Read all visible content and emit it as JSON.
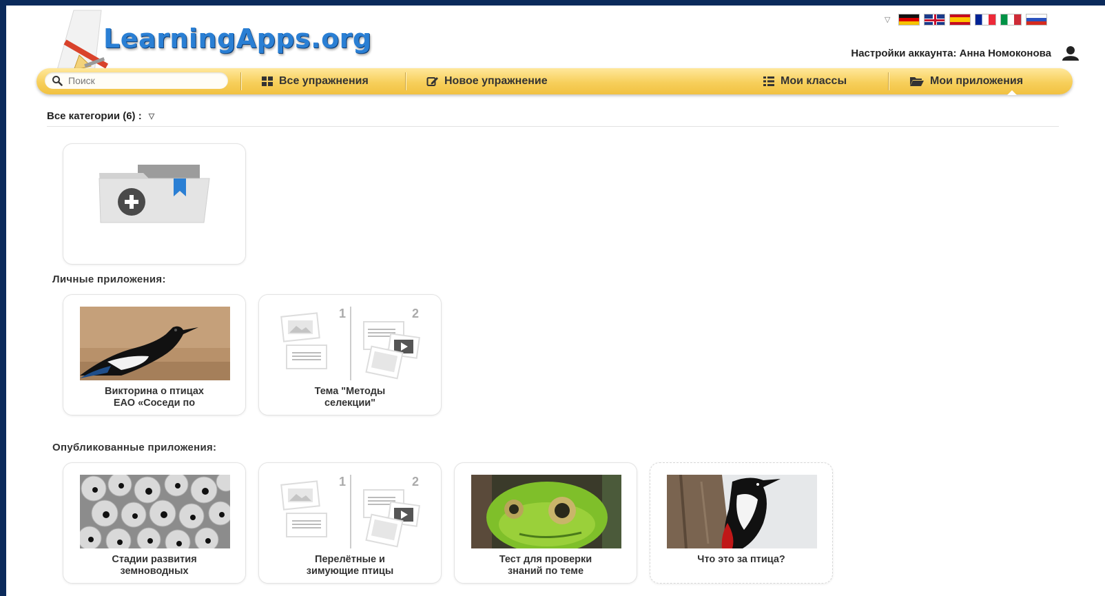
{
  "header": {
    "logo_text": "LearningApps.org",
    "account_label": "Настройки аккаунта: Анна Номоконова",
    "languages": [
      "de",
      "gb",
      "es",
      "fr",
      "it",
      "ru"
    ]
  },
  "nav": {
    "search_placeholder": "Поиск",
    "all_exercises": "Все упражнения",
    "new_exercise": "Новое упражнение",
    "my_classes": "Мои классы",
    "my_apps": "Мои приложения",
    "active": "my_apps"
  },
  "categories": {
    "label": "Все категории (6) :"
  },
  "sections": {
    "personal": {
      "title": "Личные приложения:",
      "apps": [
        {
          "title_line1": "Викторина о птицах",
          "title_line2": "ЕАО «Соседи по",
          "thumb": "magpie-photo"
        },
        {
          "title_line1": "Тема \"Методы",
          "title_line2": "селекции\"",
          "thumb": "app-template-placeholder",
          "step1": "1",
          "step2": "2"
        }
      ]
    },
    "published": {
      "title": "Опубликованные приложения:",
      "apps": [
        {
          "title_line1": "Стадии развития",
          "title_line2": "земноводных",
          "thumb": "frog-eggs-photo"
        },
        {
          "title_line1": "Перелётные и",
          "title_line2": "зимующие птицы",
          "thumb": "app-template-placeholder",
          "step1": "1",
          "step2": "2"
        },
        {
          "title_line1": "Тест для проверки",
          "title_line2": "знаний по теме",
          "thumb": "frog-photo"
        },
        {
          "title_line1": "Что это за птица?",
          "title_line2": "",
          "thumb": "woodpecker-photo"
        }
      ]
    }
  },
  "colors": {
    "frame": "#0b2a5b",
    "navbar": "#f7cf5b",
    "logo": "#2a7fd4"
  }
}
